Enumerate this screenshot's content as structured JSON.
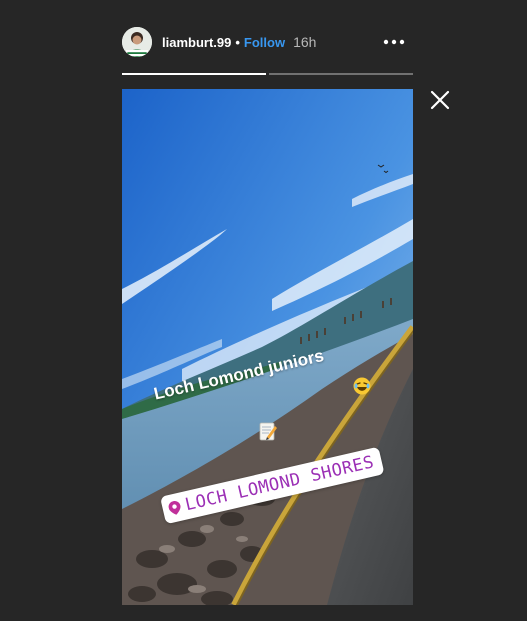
{
  "header": {
    "username": "liamburt.99",
    "separator": "•",
    "follow_label": "Follow",
    "time_ago": "16h",
    "avatar_icon": "user-avatar",
    "more_icon": "more-options-icon"
  },
  "progress": {
    "segments": 2,
    "current_segment": 1,
    "current_fraction": 1.0
  },
  "close_icon": "close-icon",
  "story": {
    "caption": "Loch Lomond juniors",
    "caption_emoji": "😂",
    "sticker_emoji": "📝",
    "location": {
      "label": "LOCH LOMOND SHORES",
      "icon": "location-pin-icon",
      "color": "#9b2fb5"
    }
  },
  "colors": {
    "background": "#262626",
    "follow": "#3897f0"
  }
}
